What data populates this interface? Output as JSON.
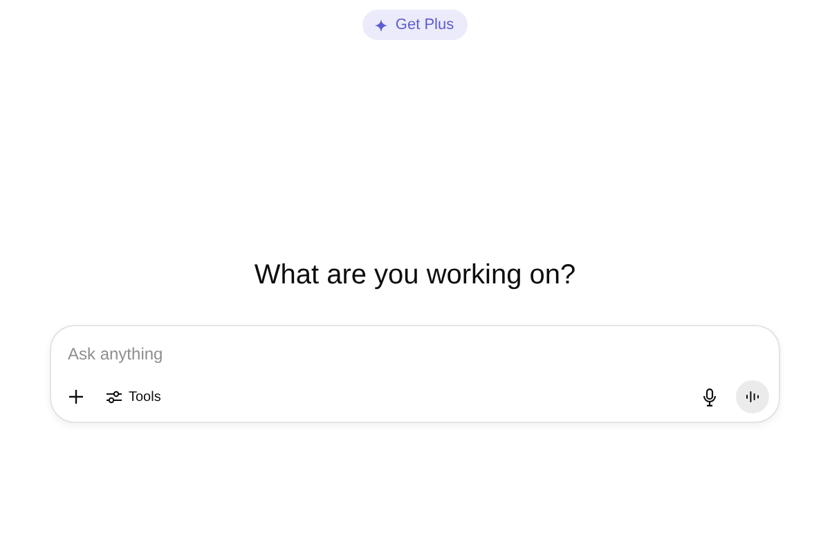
{
  "upgrade_button": {
    "label": "Get Plus"
  },
  "heading": "What are you working on?",
  "composer": {
    "placeholder": "Ask anything",
    "tools_button": {
      "label": "Tools"
    }
  }
}
